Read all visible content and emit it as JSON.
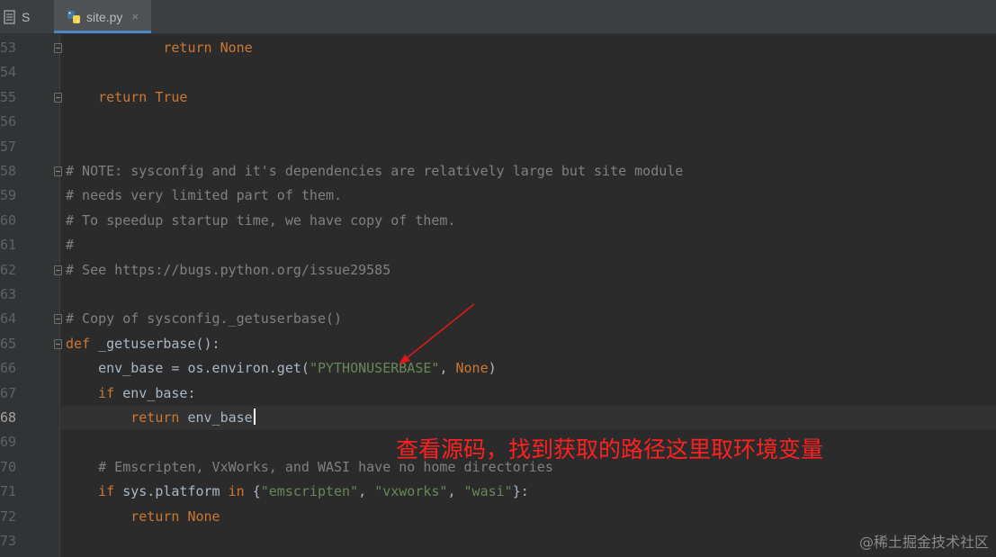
{
  "tabs": [
    {
      "label": "S"
    },
    {
      "label": "site.py",
      "close": "×"
    }
  ],
  "editor": {
    "current_line": "68",
    "lines": [
      {
        "num": "53",
        "html": "            <span class=\"kw\">return None</span>"
      },
      {
        "num": "54",
        "html": ""
      },
      {
        "num": "55",
        "html": "    <span class=\"kw\">return True</span>"
      },
      {
        "num": "56",
        "html": ""
      },
      {
        "num": "57",
        "html": ""
      },
      {
        "num": "58",
        "html": "<span class=\"cm\"># NOTE: sysconfig and it's dependencies are relatively large but site module</span>"
      },
      {
        "num": "59",
        "html": "<span class=\"cm\"># needs very limited part of them.</span>"
      },
      {
        "num": "60",
        "html": "<span class=\"cm\"># To speedup startup time, we have copy of them.</span>"
      },
      {
        "num": "61",
        "html": "<span class=\"cm\">#</span>"
      },
      {
        "num": "62",
        "html": "<span class=\"cm\"># See https://bugs.python.org/issue29585</span>"
      },
      {
        "num": "63",
        "html": ""
      },
      {
        "num": "64",
        "html": "<span class=\"cm\"># Copy of sysconfig._getuserbase()</span>"
      },
      {
        "num": "65",
        "html": "<span class=\"kw\">def</span> _getuserbase():"
      },
      {
        "num": "66",
        "html": "    env_base = os.environ.get(<span class=\"st\">\"PYTHONUSERBASE\"</span>, <span class=\"kw\">None</span>)"
      },
      {
        "num": "67",
        "html": "    <span class=\"kw\">if</span> env_base:"
      },
      {
        "num": "68",
        "html": "        <span class=\"kw\">return</span> env_base<span class=\"caret\"></span>"
      },
      {
        "num": "69",
        "html": ""
      },
      {
        "num": "70",
        "html": "    <span class=\"cm\"># Emscripten, VxWorks, and WASI have no home directories</span>"
      },
      {
        "num": "71",
        "html": "    <span class=\"kw\">if</span> sys.platform <span class=\"kw\">in</span> {<span class=\"st\">\"emscripten\"</span>, <span class=\"st\">\"vxworks\"</span>, <span class=\"st\">\"wasi\"</span>}:"
      },
      {
        "num": "72",
        "html": "        <span class=\"kw\">return None</span>"
      },
      {
        "num": "73",
        "html": ""
      }
    ]
  },
  "annotation": {
    "text": "查看源码，找到获取的路径这里取环境变量"
  },
  "watermark": {
    "text": "@稀土掘金技术社区"
  },
  "colors": {
    "keyword": "#cc7832",
    "comment": "#808080",
    "string": "#6a8759",
    "annotation": "#ff2020"
  }
}
